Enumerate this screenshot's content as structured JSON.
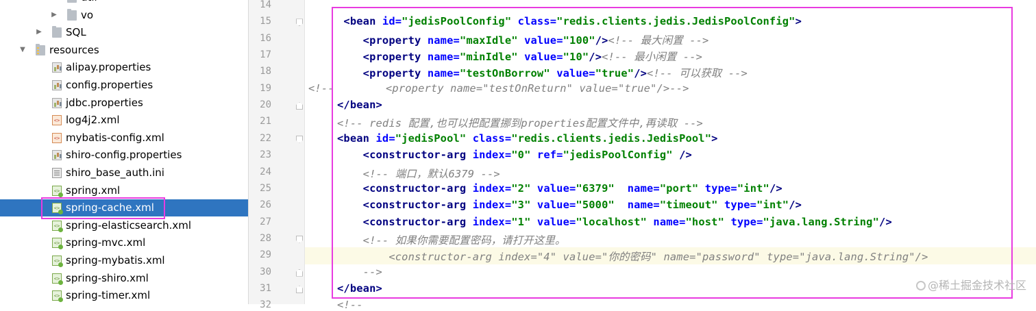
{
  "project_tree": [
    {
      "label": "util",
      "icon": "folder-icon",
      "level": 4,
      "expandable": true,
      "expanded": false
    },
    {
      "label": "vo",
      "icon": "folder-icon",
      "level": 4,
      "expandable": true,
      "expanded": false
    },
    {
      "label": "SQL",
      "icon": "folder-icon",
      "level": 3,
      "expandable": true,
      "expanded": false
    },
    {
      "label": "resources",
      "icon": "resources-folder-icon",
      "level": 2,
      "expandable": true,
      "expanded": true
    },
    {
      "label": "alipay.properties",
      "icon": "properties-file-icon",
      "level": 3
    },
    {
      "label": "config.properties",
      "icon": "properties-file-icon",
      "level": 3
    },
    {
      "label": "jdbc.properties",
      "icon": "properties-file-icon",
      "level": 3
    },
    {
      "label": "log4j2.xml",
      "icon": "xml-file-icon",
      "level": 3
    },
    {
      "label": "mybatis-config.xml",
      "icon": "xml-file-icon",
      "level": 3
    },
    {
      "label": "shiro-config.properties",
      "icon": "properties-file-icon",
      "level": 3
    },
    {
      "label": "shiro_base_auth.ini",
      "icon": "ini-file-icon",
      "level": 3
    },
    {
      "label": "spring.xml",
      "icon": "spring-xml-file-icon",
      "level": 3
    },
    {
      "label": "spring-cache.xml",
      "icon": "spring-xml-file-icon",
      "level": 3,
      "selected": true
    },
    {
      "label": "spring-elasticsearch.xml",
      "icon": "spring-xml-file-icon",
      "level": 3
    },
    {
      "label": "spring-mvc.xml",
      "icon": "spring-xml-file-icon",
      "level": 3
    },
    {
      "label": "spring-mybatis.xml",
      "icon": "spring-xml-file-icon",
      "level": 3
    },
    {
      "label": "spring-shiro.xml",
      "icon": "spring-xml-file-icon",
      "level": 3
    },
    {
      "label": "spring-timer.xml",
      "icon": "spring-xml-file-icon",
      "level": 3
    }
  ],
  "editor": {
    "current_line": 29,
    "lines": [
      {
        "no": "14",
        "fold": "",
        "tokens": []
      },
      {
        "no": "15",
        "fold": "open",
        "tokens": [
          {
            "t": " ",
            "c": "plain"
          },
          {
            "t": "<bean ",
            "c": "tag"
          },
          {
            "t": "id=",
            "c": "attr"
          },
          {
            "t": "\"jedisPoolConfig\" ",
            "c": "val"
          },
          {
            "t": "class=",
            "c": "attr"
          },
          {
            "t": "\"redis.clients.jedis.JedisPoolConfig\"",
            "c": "val"
          },
          {
            "t": ">",
            "c": "tag"
          }
        ]
      },
      {
        "no": "16",
        "fold": "",
        "tokens": [
          {
            "t": "    ",
            "c": "plain"
          },
          {
            "t": "<property ",
            "c": "tag"
          },
          {
            "t": "name=",
            "c": "attr"
          },
          {
            "t": "\"maxIdle\" ",
            "c": "val"
          },
          {
            "t": "value=",
            "c": "attr"
          },
          {
            "t": "\"100\"",
            "c": "val"
          },
          {
            "t": "/>",
            "c": "tag"
          },
          {
            "t": "<!-- 最大闲置 -->",
            "c": "cmt"
          }
        ]
      },
      {
        "no": "17",
        "fold": "",
        "tokens": [
          {
            "t": "    ",
            "c": "plain"
          },
          {
            "t": "<property ",
            "c": "tag"
          },
          {
            "t": "name=",
            "c": "attr"
          },
          {
            "t": "\"minIdle\" ",
            "c": "val"
          },
          {
            "t": "value=",
            "c": "attr"
          },
          {
            "t": "\"10\"",
            "c": "val"
          },
          {
            "t": "/>",
            "c": "tag"
          },
          {
            "t": "<!-- 最小闲置 -->",
            "c": "cmt"
          }
        ]
      },
      {
        "no": "18",
        "fold": "",
        "tokens": [
          {
            "t": "    ",
            "c": "plain"
          },
          {
            "t": "<property ",
            "c": "tag"
          },
          {
            "t": "name=",
            "c": "attr"
          },
          {
            "t": "\"testOnBorrow\" ",
            "c": "val"
          },
          {
            "t": "value=",
            "c": "attr"
          },
          {
            "t": "\"true\"",
            "c": "val"
          },
          {
            "t": "/>",
            "c": "tag"
          },
          {
            "t": "<!-- 可以获取 -->",
            "c": "cmt"
          }
        ]
      },
      {
        "no": "19",
        "fold": "",
        "tokens": [
          {
            "t": "<!--        <property name=\"testOnReturn\" value=\"true\"/>-->",
            "c": "cmt"
          }
        ]
      },
      {
        "no": "20",
        "fold": "close",
        "tokens": [
          {
            "t": "</bean>",
            "c": "tag"
          }
        ]
      },
      {
        "no": "21",
        "fold": "",
        "tokens": [
          {
            "t": "<!-- redis 配置,也可以把配置挪到properties配置文件中,再读取 -->",
            "c": "cmt"
          }
        ]
      },
      {
        "no": "22",
        "fold": "open",
        "tokens": [
          {
            "t": "<bean ",
            "c": "tag"
          },
          {
            "t": "id=",
            "c": "attr"
          },
          {
            "t": "\"jedisPool\" ",
            "c": "val"
          },
          {
            "t": "class=",
            "c": "attr"
          },
          {
            "t": "\"redis.clients.jedis.JedisPool\"",
            "c": "val"
          },
          {
            "t": ">",
            "c": "tag"
          }
        ]
      },
      {
        "no": "23",
        "fold": "",
        "tokens": [
          {
            "t": "    ",
            "c": "plain"
          },
          {
            "t": "<constructor-arg ",
            "c": "tag"
          },
          {
            "t": "index=",
            "c": "attr"
          },
          {
            "t": "\"0\" ",
            "c": "val"
          },
          {
            "t": "ref=",
            "c": "attr"
          },
          {
            "t": "\"jedisPoolConfig\" ",
            "c": "val"
          },
          {
            "t": "/>",
            "c": "tag"
          }
        ]
      },
      {
        "no": "24",
        "fold": "",
        "tokens": [
          {
            "t": "    ",
            "c": "plain"
          },
          {
            "t": "<!-- 端口，默认6379 -->",
            "c": "cmt"
          }
        ]
      },
      {
        "no": "25",
        "fold": "",
        "tokens": [
          {
            "t": "    ",
            "c": "plain"
          },
          {
            "t": "<constructor-arg ",
            "c": "tag"
          },
          {
            "t": "index=",
            "c": "attr"
          },
          {
            "t": "\"2\" ",
            "c": "val"
          },
          {
            "t": "value=",
            "c": "attr"
          },
          {
            "t": "\"6379\"  ",
            "c": "val"
          },
          {
            "t": "name=",
            "c": "attr"
          },
          {
            "t": "\"port\" ",
            "c": "val"
          },
          {
            "t": "type=",
            "c": "attr"
          },
          {
            "t": "\"int\"",
            "c": "val"
          },
          {
            "t": "/>",
            "c": "tag"
          }
        ]
      },
      {
        "no": "26",
        "fold": "",
        "tokens": [
          {
            "t": "    ",
            "c": "plain"
          },
          {
            "t": "<constructor-arg ",
            "c": "tag"
          },
          {
            "t": "index=",
            "c": "attr"
          },
          {
            "t": "\"3\" ",
            "c": "val"
          },
          {
            "t": "value=",
            "c": "attr"
          },
          {
            "t": "\"5000\"  ",
            "c": "val"
          },
          {
            "t": "name=",
            "c": "attr"
          },
          {
            "t": "\"timeout\" ",
            "c": "val"
          },
          {
            "t": "type=",
            "c": "attr"
          },
          {
            "t": "\"int\"",
            "c": "val"
          },
          {
            "t": "/>",
            "c": "tag"
          }
        ]
      },
      {
        "no": "27",
        "fold": "",
        "tokens": [
          {
            "t": "    ",
            "c": "plain"
          },
          {
            "t": "<constructor-arg ",
            "c": "tag"
          },
          {
            "t": "index=",
            "c": "attr"
          },
          {
            "t": "\"1\" ",
            "c": "val"
          },
          {
            "t": "value=",
            "c": "attr"
          },
          {
            "t": "\"localhost\" ",
            "c": "val"
          },
          {
            "t": "name=",
            "c": "attr"
          },
          {
            "t": "\"host\" ",
            "c": "val"
          },
          {
            "t": "type=",
            "c": "attr"
          },
          {
            "t": "\"java.lang.String\"",
            "c": "val"
          },
          {
            "t": "/>",
            "c": "tag"
          }
        ]
      },
      {
        "no": "28",
        "fold": "open",
        "tokens": [
          {
            "t": "    ",
            "c": "plain"
          },
          {
            "t": "<!-- 如果你需要配置密码，请打开这里。",
            "c": "cmt"
          }
        ]
      },
      {
        "no": "29",
        "fold": "",
        "tokens": [
          {
            "t": "        <constructor-arg index=\"4\" value=\"你的密码\" name=\"password\" type=\"java.lang.String\"/>",
            "c": "cmt"
          }
        ]
      },
      {
        "no": "30",
        "fold": "close",
        "tokens": [
          {
            "t": "    -->",
            "c": "cmt"
          }
        ]
      },
      {
        "no": "31",
        "fold": "close",
        "tokens": [
          {
            "t": "</bean>",
            "c": "tag"
          }
        ]
      },
      {
        "no": "32",
        "fold": "",
        "tokens": [
          {
            "t": "<!--",
            "c": "cmt"
          }
        ]
      }
    ]
  },
  "watermark": "@稀土掘金技术社区",
  "annotation_color": "#e83be0"
}
